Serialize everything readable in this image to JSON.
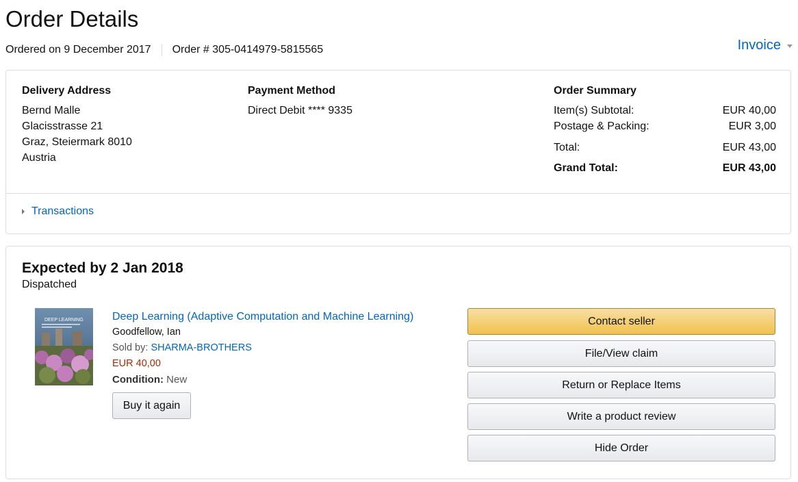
{
  "page": {
    "title": "Order Details"
  },
  "meta": {
    "ordered_on": "Ordered on 9 December 2017",
    "order_number": "Order # 305-0414979-5815565"
  },
  "invoice": {
    "label": "Invoice"
  },
  "delivery": {
    "heading": "Delivery Address",
    "lines": [
      "Bernd Malle",
      "Glacisstrasse 21",
      "Graz, Steiermark 8010",
      "Austria"
    ]
  },
  "payment": {
    "heading": "Payment Method",
    "method": "Direct Debit **** 9335"
  },
  "summary": {
    "heading": "Order Summary",
    "rows": [
      {
        "label": "Item(s) Subtotal:",
        "value": "EUR 40,00"
      },
      {
        "label": "Postage & Packing:",
        "value": "EUR 3,00"
      },
      {
        "label": "Total:",
        "value": "EUR 43,00"
      },
      {
        "label": "Grand Total:",
        "value": "EUR 43,00"
      }
    ]
  },
  "transactions": {
    "label": "Transactions"
  },
  "shipment": {
    "expected": "Expected by 2 Jan 2018",
    "status": "Dispatched"
  },
  "item": {
    "title": "Deep Learning (Adaptive Computation and Machine Learning)",
    "author": "Goodfellow, Ian",
    "sold_by_label": "Sold by:",
    "seller": "SHARMA-BROTHERS",
    "price": "EUR 40,00",
    "condition_label": "Condition:",
    "condition": "New",
    "cover_title": "DEEP LEARNING",
    "buy_again": "Buy it again"
  },
  "actions": [
    "Contact seller",
    "File/View claim",
    "Return or Replace Items",
    "Write a product review",
    "Hide Order"
  ],
  "colors": {
    "link": "#0066c0",
    "price": "#b12704",
    "primary_button": "#f0c14b",
    "border": "#dddddd"
  }
}
